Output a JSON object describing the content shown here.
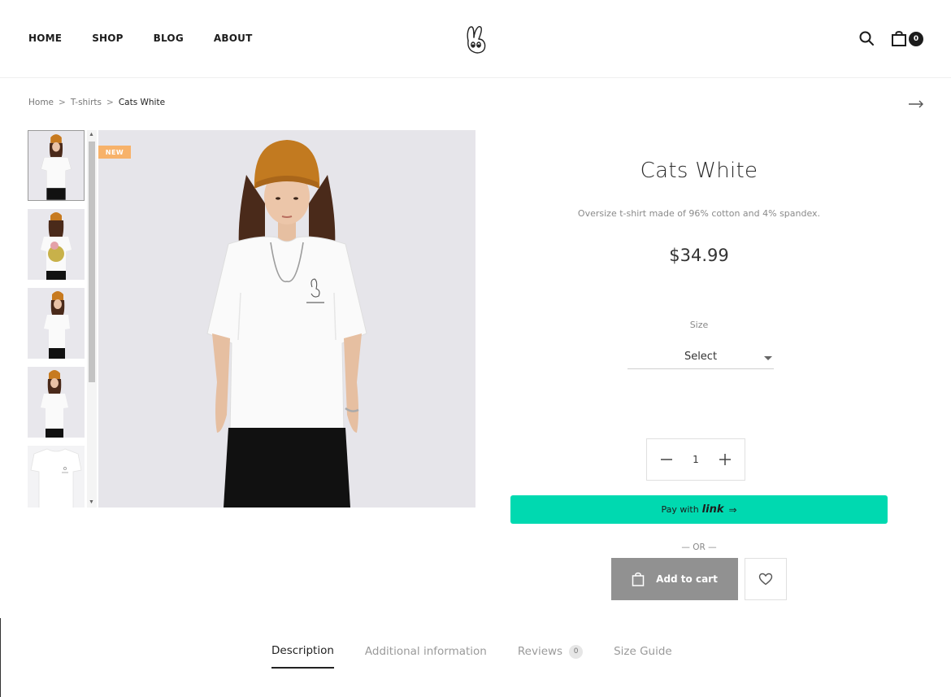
{
  "header": {
    "nav": [
      "HOME",
      "SHOP",
      "BLOG",
      "ABOUT"
    ],
    "cart_count": "0"
  },
  "breadcrumb": {
    "items": [
      "Home",
      "T-shirts"
    ],
    "current": "Cats White",
    "separator": ">"
  },
  "gallery": {
    "badge": "NEW"
  },
  "product": {
    "title": "Cats White",
    "description": "Oversize t-shirt made of 96% cotton and 4% spandex.",
    "price": "$34.99",
    "size_label": "Size",
    "size_value": "Select",
    "quantity": "1"
  },
  "actions": {
    "pay_prefix": "Pay with",
    "pay_brand": "link",
    "or_text": "— OR —",
    "add_to_cart": "Add to cart"
  },
  "tabs": [
    {
      "label": "Description"
    },
    {
      "label": "Additional information"
    },
    {
      "label": "Reviews",
      "count": "0"
    },
    {
      "label": "Size Guide"
    }
  ],
  "colors": {
    "accent_pay": "#00d9b0",
    "add_to_cart_bg": "#919191",
    "badge_new": "#f7b26a"
  }
}
